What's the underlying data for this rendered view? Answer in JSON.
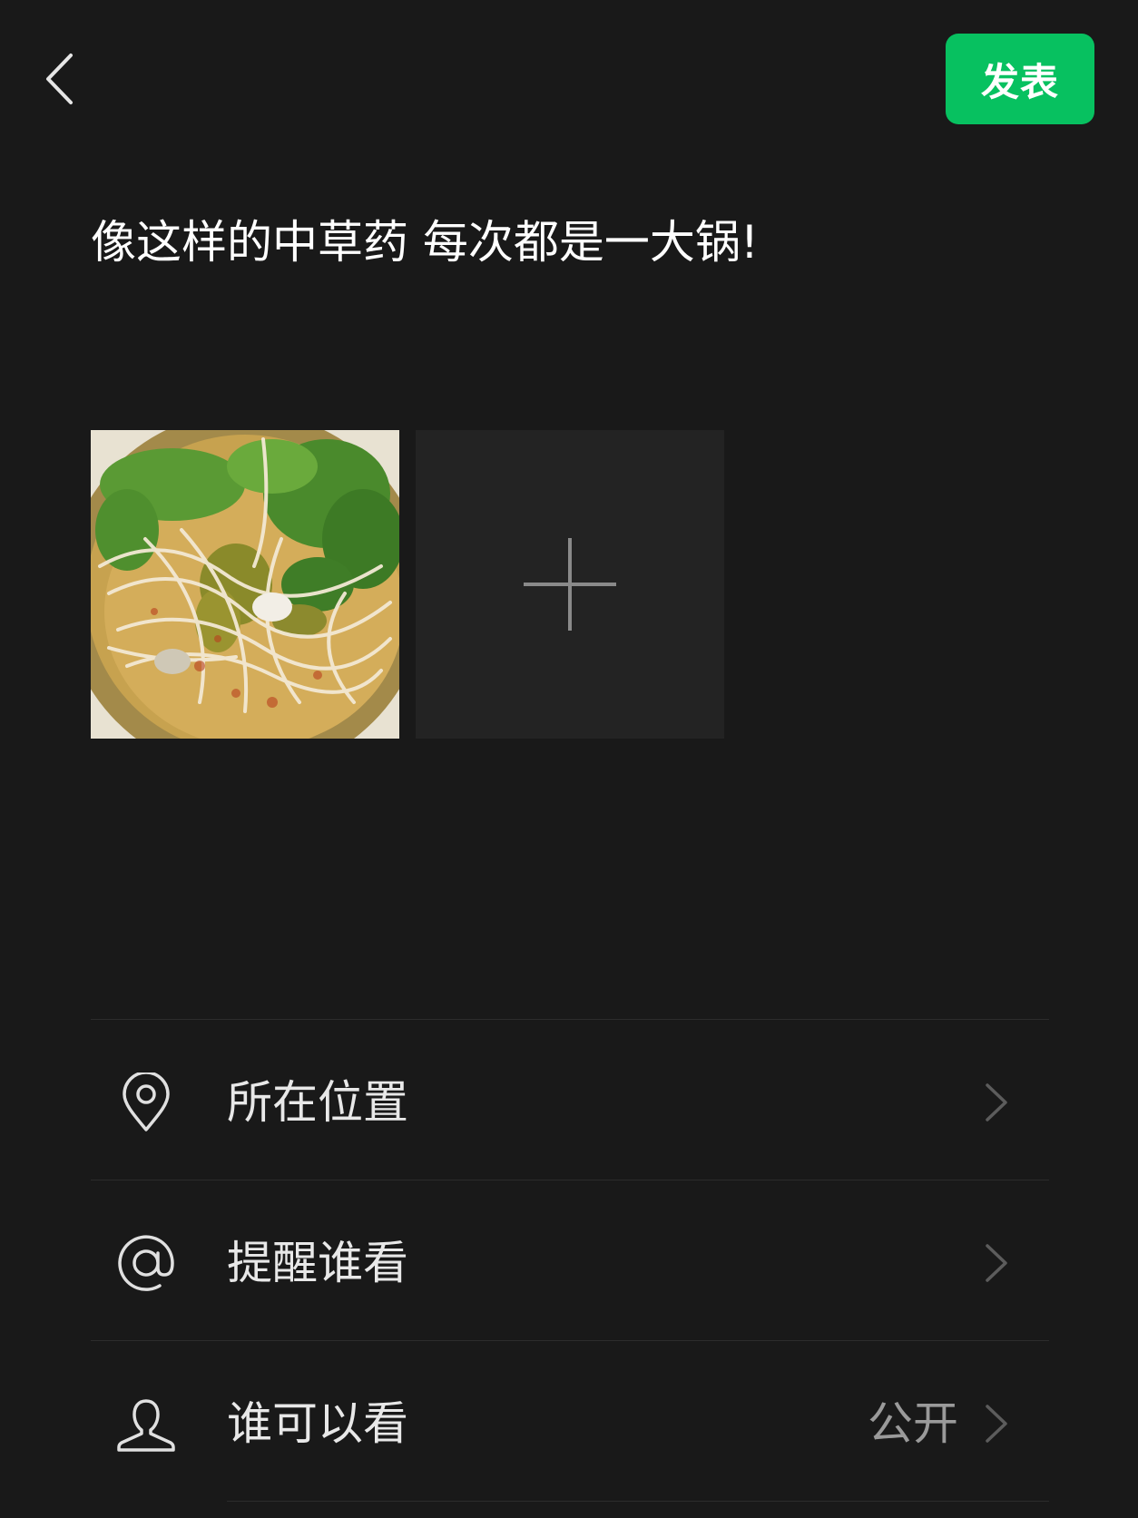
{
  "header": {
    "back_icon": "chevron-left-icon",
    "post_label": "发表"
  },
  "post": {
    "text": "像这样的中草药 每次都是一大锅!"
  },
  "media": {
    "photo_icon": "food-photo",
    "add_icon": "plus-icon"
  },
  "options": [
    {
      "label": "所在位置",
      "icon": "location-pin-icon",
      "value": ""
    },
    {
      "label": "提醒谁看",
      "icon": "at-sign-icon",
      "value": ""
    },
    {
      "label": "谁可以看",
      "icon": "person-icon",
      "value": "公开"
    }
  ],
  "colors": {
    "background": "#191919",
    "accent": "#07c160",
    "tile": "#232323"
  }
}
